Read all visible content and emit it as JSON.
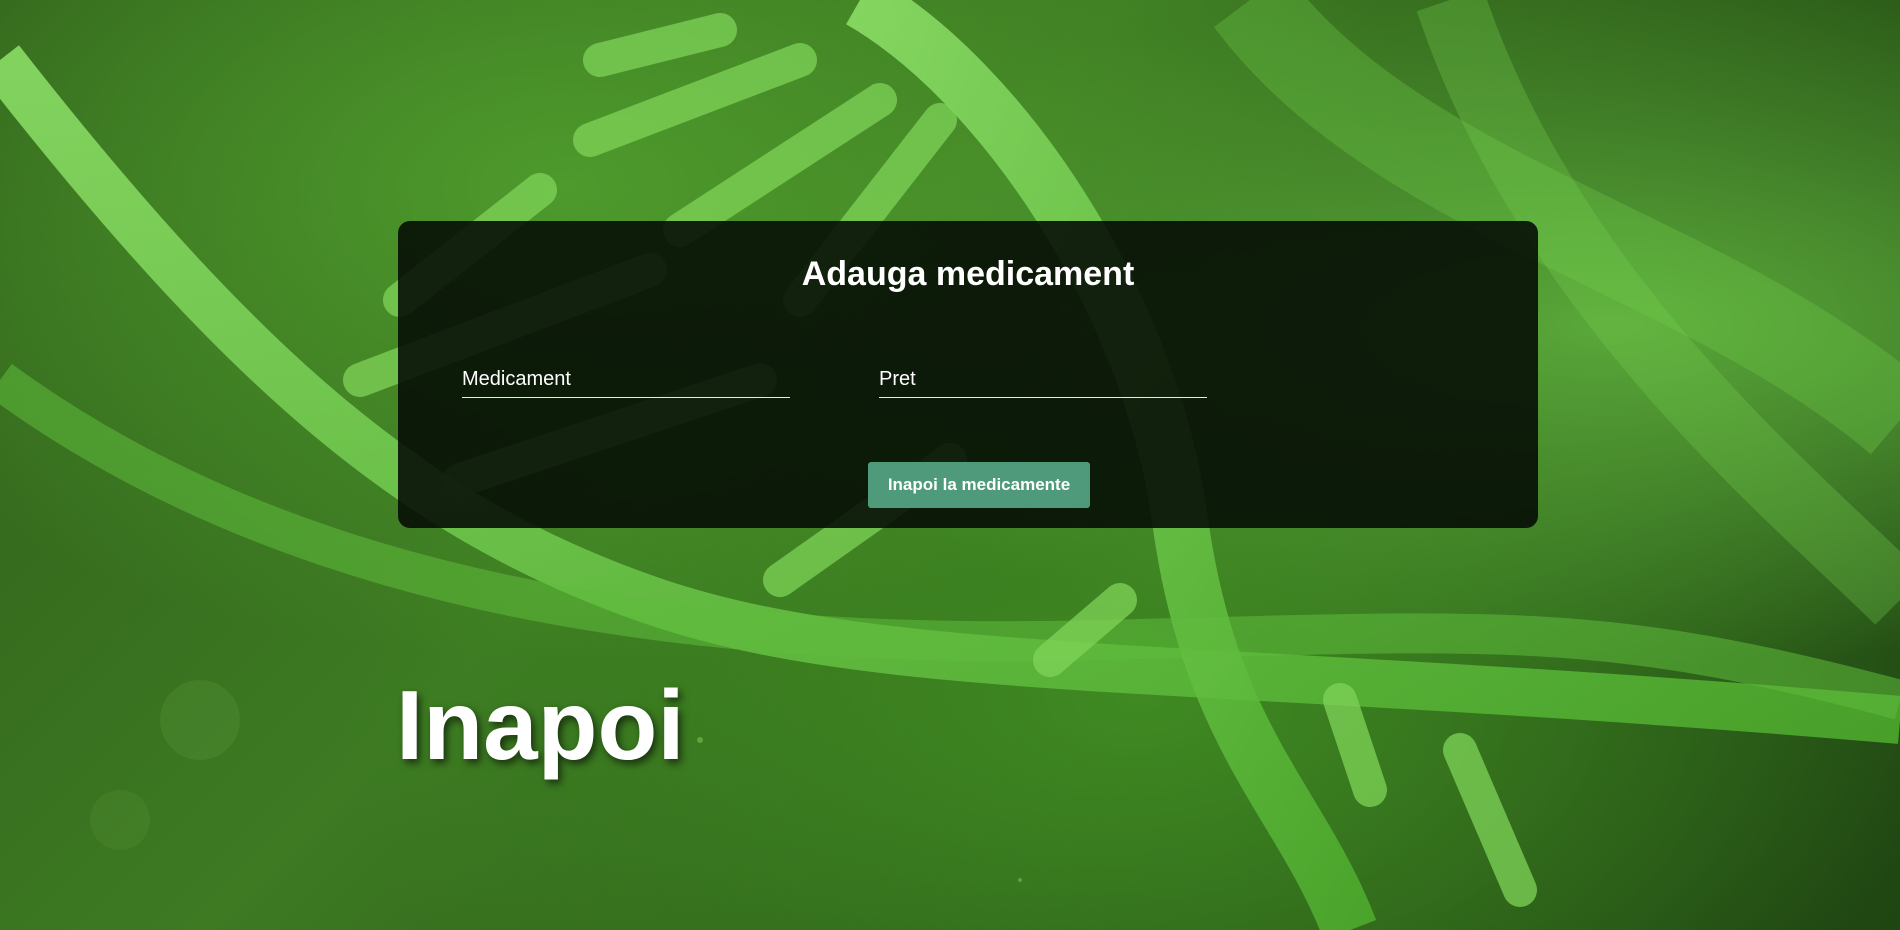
{
  "form": {
    "title": "Adauga medicament",
    "medicament_placeholder": "Medicament",
    "pret_placeholder": "Pret",
    "back_button_label": "Inapoi la medicamente"
  },
  "page": {
    "back_link_label": "Inapoi"
  },
  "colors": {
    "card_background": "#050a05",
    "button_accent": "#4f9a7a",
    "background_green": "#3d7a22"
  },
  "icons": {
    "background": "dna-helix-image"
  }
}
